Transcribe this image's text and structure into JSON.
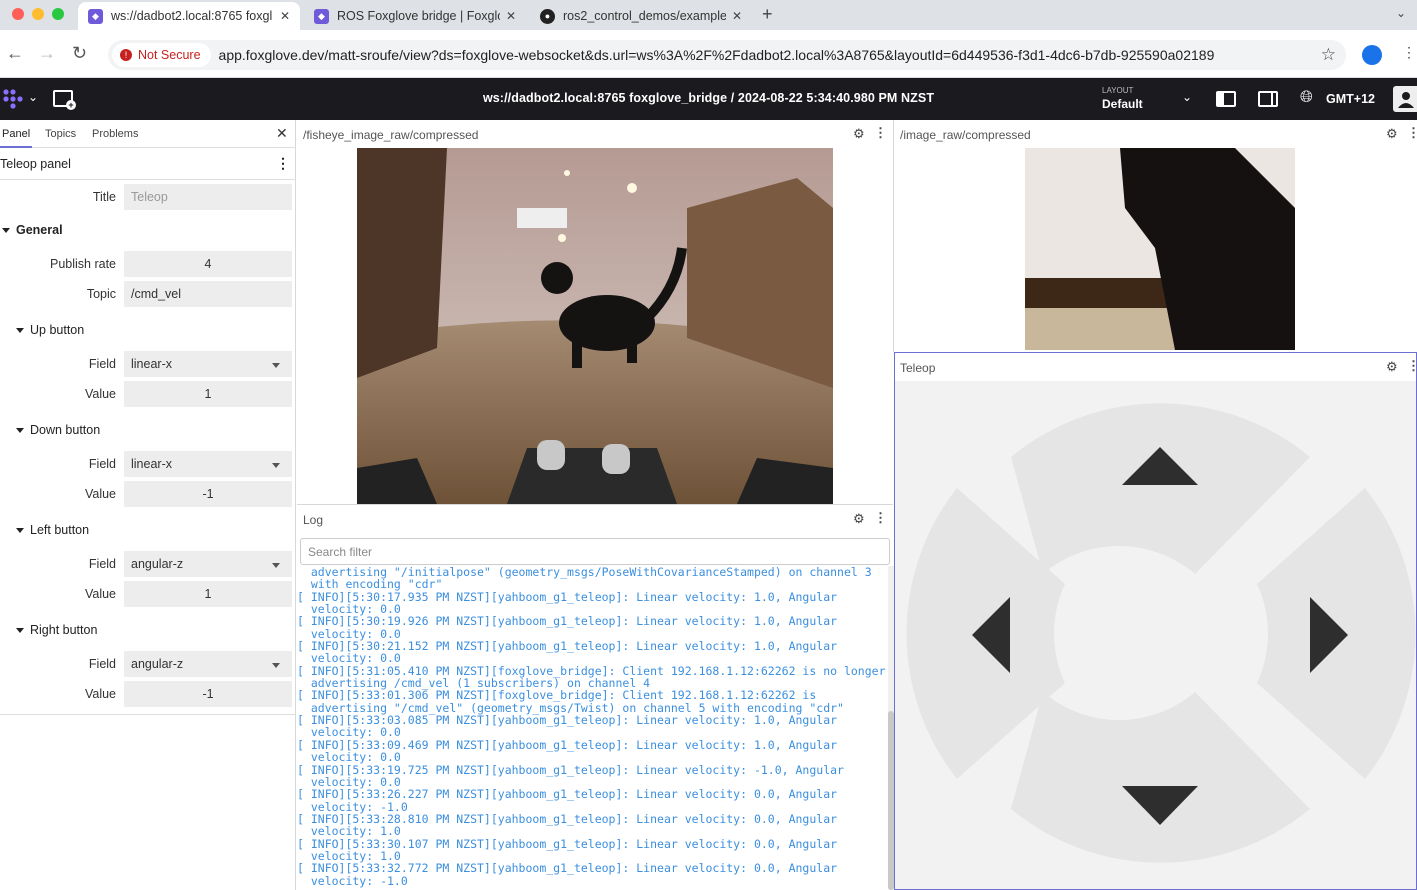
{
  "browser": {
    "tabs": [
      {
        "title": "ws://dadbot2.local:8765 foxgl",
        "active": true
      },
      {
        "title": "ROS Foxglove bridge | Foxglo",
        "active": false
      },
      {
        "title": "ros2_control_demos/example",
        "active": false
      }
    ],
    "security_label": "Not Secure",
    "url": "app.foxglove.dev/matt-sroufe/view?ds=foxglove-websocket&ds.url=ws%3A%2F%2Fdadbot2.local%3A8765&layoutId=6d449536-f3d1-4dc6-b7db-925590a02189"
  },
  "appbar": {
    "title": "ws://dadbot2.local:8765 foxglove_bridge / 2024-08-22 5:34:40.980 PM NZST",
    "layout_caption": "LAYOUT",
    "layout_value": "Default",
    "timezone": "GMT+12"
  },
  "sidebar": {
    "tabs": [
      "Panel",
      "Topics",
      "Problems"
    ],
    "panel_title": "Teleop panel",
    "title_label": "Title",
    "title_placeholder": "Teleop",
    "general_label": "General",
    "publish_rate_label": "Publish rate",
    "publish_rate": "4",
    "topic_label": "Topic",
    "topic": "/cmd_vel",
    "field_label": "Field",
    "value_label": "Value",
    "buttons": [
      {
        "name": "Up button",
        "field": "linear-x",
        "value": "1"
      },
      {
        "name": "Down button",
        "field": "linear-x",
        "value": "-1"
      },
      {
        "name": "Left button",
        "field": "angular-z",
        "value": "1"
      },
      {
        "name": "Right button",
        "field": "angular-z",
        "value": "-1"
      }
    ]
  },
  "panels": {
    "fisheye_title": "/fisheye_image_raw/compressed",
    "image_title": "/image_raw/compressed",
    "log_title": "Log",
    "log_filter_placeholder": "Search filter",
    "teleop_title": "Teleop"
  },
  "log": [
    "  advertising \"/initialpose\" (geometry_msgs/PoseWithCovarianceStamped) on channel 3",
    "  with encoding \"cdr\"",
    "[ INFO][5:30:17.935 PM NZST][yahboom_g1_teleop]: Linear velocity: 1.0, Angular",
    "  velocity: 0.0",
    "[ INFO][5:30:19.926 PM NZST][yahboom_g1_teleop]: Linear velocity: 1.0, Angular",
    "  velocity: 0.0",
    "[ INFO][5:30:21.152 PM NZST][yahboom_g1_teleop]: Linear velocity: 1.0, Angular",
    "  velocity: 0.0",
    "[ INFO][5:31:05.410 PM NZST][foxglove_bridge]: Client 192.168.1.12:62262 is no longer",
    "  advertising /cmd_vel (1 subscribers) on channel 4",
    "[ INFO][5:33:01.306 PM NZST][foxglove_bridge]: Client 192.168.1.12:62262 is",
    "  advertising \"/cmd_vel\" (geometry_msgs/Twist) on channel 5 with encoding \"cdr\"",
    "[ INFO][5:33:03.085 PM NZST][yahboom_g1_teleop]: Linear velocity: 1.0, Angular",
    "  velocity: 0.0",
    "[ INFO][5:33:09.469 PM NZST][yahboom_g1_teleop]: Linear velocity: 1.0, Angular",
    "  velocity: 0.0",
    "[ INFO][5:33:19.725 PM NZST][yahboom_g1_teleop]: Linear velocity: -1.0, Angular",
    "  velocity: 0.0",
    "[ INFO][5:33:26.227 PM NZST][yahboom_g1_teleop]: Linear velocity: 0.0, Angular",
    "  velocity: -1.0",
    "[ INFO][5:33:28.810 PM NZST][yahboom_g1_teleop]: Linear velocity: 0.0, Angular",
    "  velocity: 1.0",
    "[ INFO][5:33:30.107 PM NZST][yahboom_g1_teleop]: Linear velocity: 0.0, Angular",
    "  velocity: 1.0",
    "[ INFO][5:33:32.772 PM NZST][yahboom_g1_teleop]: Linear velocity: 0.0, Angular",
    "  velocity: -1.0"
  ],
  "colors": {
    "appbar_bg": "#1a1a1f",
    "log_text": "#3b8fdf",
    "accent": "#6c6fd1",
    "not_secure": "#c5221f"
  }
}
